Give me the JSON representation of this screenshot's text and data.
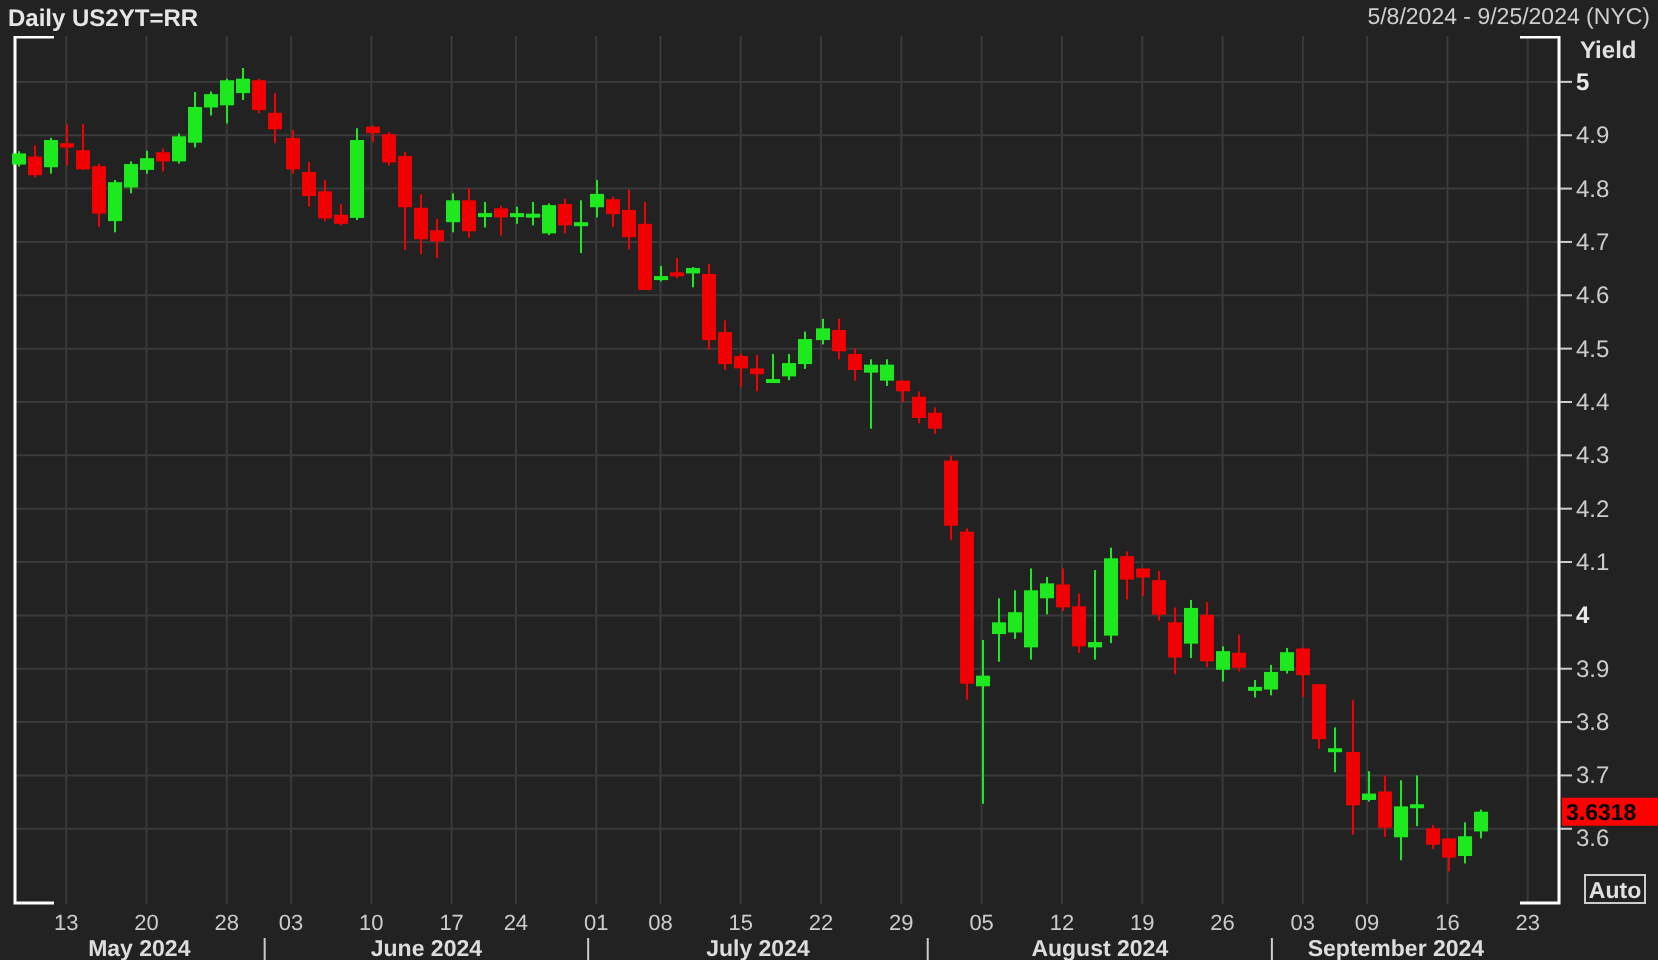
{
  "header": {
    "title": "Daily US2YT=RR",
    "date_range": "5/8/2024 - 9/25/2024 (NYC)"
  },
  "chart": {
    "last_value": "3.6318",
    "auto_button": "Auto",
    "month_labels": [
      "May 2024",
      "June 2024",
      "July 2024",
      "August 2024",
      "September 2024"
    ],
    "chart_data": {
      "type": "candlestick",
      "ylabel": "Yield",
      "grid": true,
      "ylim": [
        3.459,
        5.086
      ],
      "categories": [
        null,
        null,
        null,
        "13",
        null,
        null,
        null,
        null,
        "20",
        null,
        null,
        null,
        null,
        "28",
        null,
        null,
        null,
        "03",
        null,
        null,
        null,
        null,
        "10",
        null,
        null,
        null,
        null,
        "17",
        null,
        null,
        null,
        "24",
        null,
        null,
        null,
        null,
        "01",
        null,
        null,
        null,
        "08",
        null,
        null,
        null,
        null,
        "15",
        null,
        null,
        null,
        null,
        "22",
        null,
        null,
        null,
        null,
        "29",
        null,
        null,
        null,
        null,
        "05",
        null,
        null,
        null,
        null,
        "12",
        null,
        null,
        null,
        null,
        "19",
        null,
        null,
        null,
        null,
        "26",
        null,
        null,
        null,
        null,
        "03",
        null,
        null,
        null,
        "09",
        null,
        null,
        null,
        null,
        "16",
        null,
        null,
        null,
        null,
        "23",
        null,
        null
      ],
      "yticks": [
        {
          "value": 5,
          "label": "5"
        },
        {
          "value": 4.9,
          "label": "4.9"
        },
        {
          "value": 4.8,
          "label": "4.8"
        },
        {
          "value": 4.7,
          "label": "4.7"
        },
        {
          "value": 4.6,
          "label": "4.6"
        },
        {
          "value": 4.5,
          "label": "4.5"
        },
        {
          "value": 4.4,
          "label": "4.4"
        },
        {
          "value": 4.3,
          "label": "4.3"
        },
        {
          "value": 4.2,
          "label": "4.2"
        },
        {
          "value": 4.1,
          "label": "4.1"
        },
        {
          "value": 4,
          "label": "4"
        },
        {
          "value": 3.9,
          "label": "3.9"
        },
        {
          "value": 3.8,
          "label": "3.8"
        },
        {
          "value": 3.7,
          "label": "3.7"
        },
        {
          "value": 3.6,
          "label": "3.6"
        }
      ],
      "ohlc": [
        [
          4.845,
          4.87,
          4.841,
          4.866
        ],
        [
          4.86,
          4.881,
          4.821,
          4.825
        ],
        [
          4.84,
          4.895,
          4.828,
          4.891
        ],
        [
          4.885,
          4.92,
          4.843,
          4.877
        ],
        [
          4.872,
          4.921,
          4.835,
          4.836
        ],
        [
          4.842,
          4.847,
          4.728,
          4.753
        ],
        [
          4.739,
          4.816,
          4.718,
          4.812
        ],
        [
          4.802,
          4.851,
          4.791,
          4.846
        ],
        [
          4.835,
          4.871,
          4.828,
          4.857
        ],
        [
          4.868,
          4.875,
          4.832,
          4.851
        ],
        [
          4.851,
          4.903,
          4.847,
          4.898
        ],
        [
          4.886,
          4.981,
          4.877,
          4.953
        ],
        [
          4.952,
          4.982,
          4.937,
          4.977
        ],
        [
          4.956,
          5.006,
          4.922,
          5.003
        ],
        [
          4.979,
          5.026,
          4.966,
          5.006
        ],
        [
          5.003,
          5.006,
          4.941,
          4.947
        ],
        [
          4.942,
          4.979,
          4.885,
          4.911
        ],
        [
          4.895,
          4.91,
          4.828,
          4.836
        ],
        [
          4.831,
          4.85,
          4.766,
          4.786
        ],
        [
          4.795,
          4.816,
          4.739,
          4.744
        ],
        [
          4.751,
          4.771,
          4.731,
          4.734
        ],
        [
          4.745,
          4.913,
          4.741,
          4.891
        ],
        [
          4.916,
          4.918,
          4.887,
          4.904
        ],
        [
          4.902,
          4.906,
          4.843,
          4.849
        ],
        [
          4.861,
          4.868,
          4.685,
          4.765
        ],
        [
          4.764,
          4.789,
          4.677,
          4.705
        ],
        [
          4.722,
          4.743,
          4.67,
          4.701
        ],
        [
          4.737,
          4.791,
          4.718,
          4.778
        ],
        [
          4.778,
          4.801,
          4.708,
          4.72
        ],
        [
          4.748,
          4.775,
          4.727,
          4.754
        ],
        [
          4.763,
          4.768,
          4.712,
          4.746
        ],
        [
          4.752,
          4.766,
          4.734,
          4.754
        ],
        [
          4.75,
          4.775,
          4.731,
          4.753
        ],
        [
          4.716,
          4.772,
          4.713,
          4.769
        ],
        [
          4.771,
          4.781,
          4.716,
          4.731
        ],
        [
          4.732,
          4.778,
          4.679,
          4.737
        ],
        [
          4.765,
          4.816,
          4.746,
          4.79
        ],
        [
          4.78,
          4.785,
          4.728,
          4.752
        ],
        [
          4.76,
          4.798,
          4.686,
          4.709
        ],
        [
          4.734,
          4.775,
          4.61,
          4.61
        ],
        [
          4.63,
          4.655,
          4.626,
          4.636
        ],
        [
          4.643,
          4.67,
          4.632,
          4.638
        ],
        [
          4.641,
          4.653,
          4.615,
          4.651
        ],
        [
          4.64,
          4.659,
          4.498,
          4.516
        ],
        [
          4.531,
          4.553,
          4.46,
          4.471
        ],
        [
          4.486,
          4.491,
          4.428,
          4.463
        ],
        [
          4.463,
          4.488,
          4.42,
          4.452
        ],
        [
          4.441,
          4.49,
          4.439,
          4.443
        ],
        [
          4.448,
          4.49,
          4.441,
          4.473
        ],
        [
          4.471,
          4.532,
          4.462,
          4.518
        ],
        [
          4.516,
          4.556,
          4.508,
          4.538
        ],
        [
          4.535,
          4.556,
          4.48,
          4.495
        ],
        [
          4.49,
          4.5,
          4.44,
          4.46
        ],
        [
          4.455,
          4.48,
          4.35,
          4.47
        ],
        [
          4.44,
          4.48,
          4.43,
          4.47
        ],
        [
          4.44,
          4.44,
          4.4,
          4.42
        ],
        [
          4.41,
          4.42,
          4.36,
          4.37
        ],
        [
          4.38,
          4.39,
          4.34,
          4.35
        ],
        [
          4.29,
          4.3,
          4.141,
          4.168
        ],
        [
          4.157,
          4.163,
          3.842,
          3.872
        ],
        [
          3.867,
          3.954,
          3.647,
          3.887
        ],
        [
          3.965,
          4.032,
          3.913,
          3.987
        ],
        [
          3.968,
          4.047,
          3.956,
          4.006
        ],
        [
          3.94,
          4.088,
          3.917,
          4.047
        ],
        [
          4.032,
          4.072,
          4.002,
          4.06
        ],
        [
          4.058,
          4.088,
          4.008,
          4.015
        ],
        [
          4.017,
          4.041,
          3.93,
          3.942
        ],
        [
          3.94,
          4.085,
          3.917,
          3.95
        ],
        [
          3.962,
          4.127,
          3.948,
          4.107
        ],
        [
          4.111,
          4.12,
          4.03,
          4.067
        ],
        [
          4.088,
          4.088,
          4.036,
          4.071
        ],
        [
          4.066,
          4.083,
          3.99,
          4.001
        ],
        [
          3.987,
          4.015,
          3.89,
          3.921
        ],
        [
          3.947,
          4.029,
          3.92,
          4.014
        ],
        [
          4.001,
          4.025,
          3.903,
          3.914
        ],
        [
          3.898,
          3.942,
          3.876,
          3.933
        ],
        [
          3.93,
          3.964,
          3.895,
          3.902
        ],
        [
          3.862,
          3.879,
          3.846,
          3.866
        ],
        [
          3.861,
          3.907,
          3.85,
          3.894
        ],
        [
          3.896,
          3.939,
          3.891,
          3.931
        ],
        [
          3.938,
          3.94,
          3.847,
          3.888
        ],
        [
          3.871,
          3.871,
          3.75,
          3.768
        ],
        [
          3.746,
          3.79,
          3.706,
          3.751
        ],
        [
          3.744,
          3.841,
          3.589,
          3.644
        ],
        [
          3.654,
          3.708,
          3.651,
          3.666
        ],
        [
          3.67,
          3.7,
          3.585,
          3.602
        ],
        [
          3.584,
          3.691,
          3.541,
          3.642
        ],
        [
          3.64,
          3.7,
          3.605,
          3.646
        ],
        [
          3.601,
          3.607,
          3.562,
          3.57
        ],
        [
          3.582,
          3.582,
          3.52,
          3.546
        ],
        [
          3.549,
          3.612,
          3.535,
          3.586
        ],
        [
          3.595,
          3.636,
          3.582,
          3.632
        ],
        null,
        null,
        null,
        null,
        null
      ]
    }
  }
}
